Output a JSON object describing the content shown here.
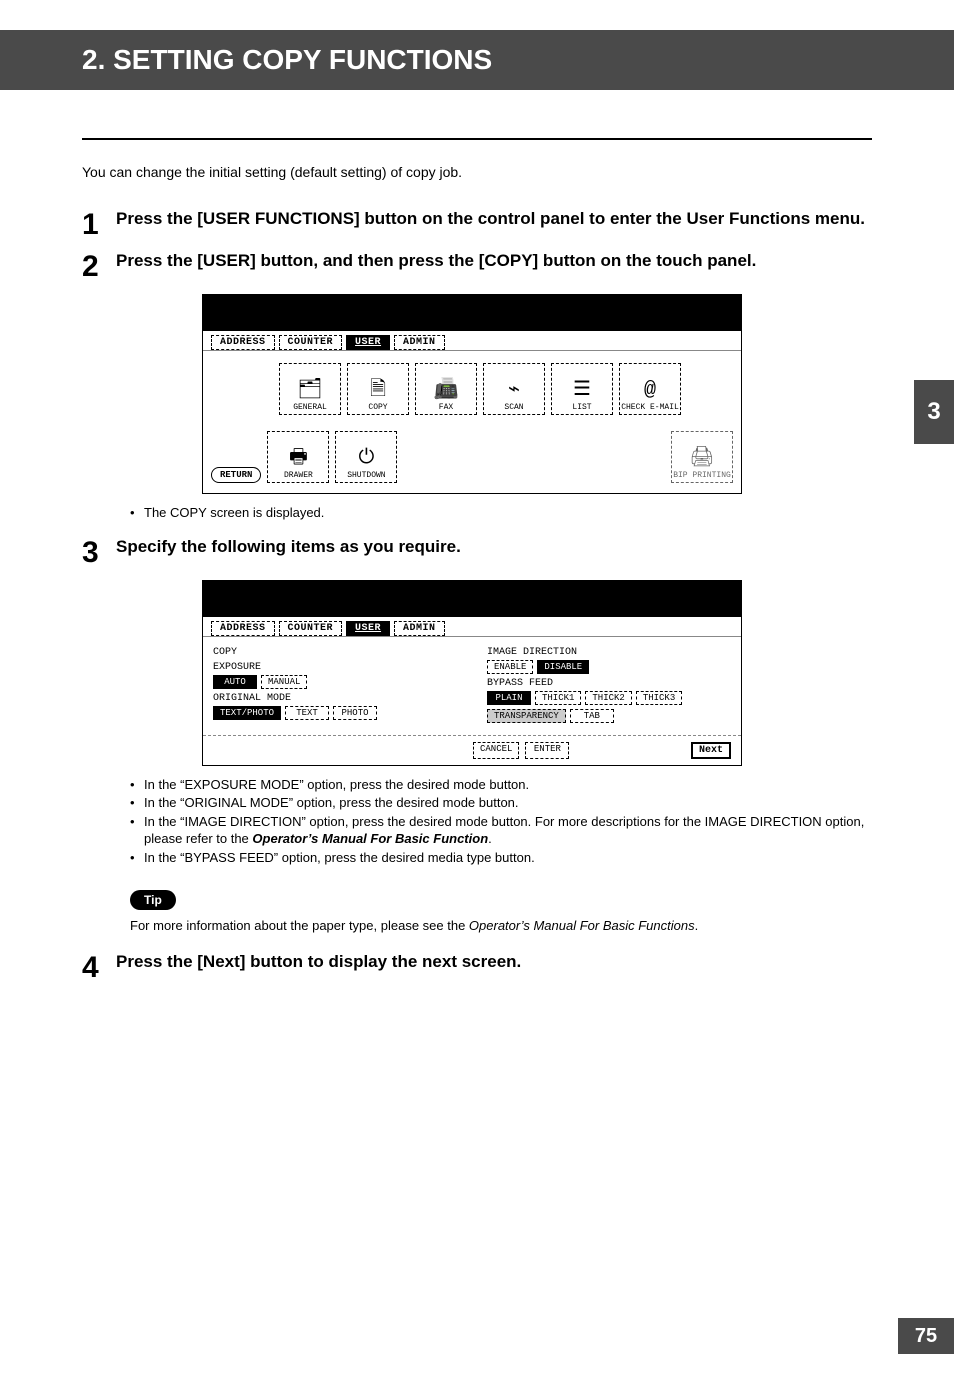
{
  "title": "2. SETTING COPY FUNCTIONS",
  "intro": "You can change the initial setting (default setting) of copy job.",
  "side_tab": "3",
  "page_number": "75",
  "steps": {
    "s1": {
      "num": "1",
      "text": "Press the [USER FUNCTIONS] button on the control panel to enter the User Functions menu."
    },
    "s2": {
      "num": "2",
      "text": "Press the [USER] button, and then press the [COPY] button on the touch panel."
    },
    "s3": {
      "num": "3",
      "text": "Specify the following items as you require."
    },
    "s4": {
      "num": "4",
      "text": "Press the [Next] button to display the next screen."
    }
  },
  "screen1": {
    "tabs": {
      "address": "ADDRESS",
      "counter": "COUNTER",
      "user": "USER",
      "admin": "ADMIN"
    },
    "buttons": {
      "general": "GENERAL",
      "copy": "COPY",
      "fax": "FAX",
      "scan": "SCAN",
      "list": "LIST",
      "check_email": "CHECK E-MAIL",
      "drawer": "DRAWER",
      "shutdown": "SHUTDOWN",
      "bip_printing": "BIP PRINTING",
      "return": "RETURN"
    }
  },
  "step2_bullet": "The COPY screen is displayed.",
  "screen2": {
    "tabs": {
      "address": "ADDRESS",
      "counter": "COUNTER",
      "user": "USER",
      "admin": "ADMIN"
    },
    "section_title": "COPY",
    "exposure": {
      "label": "EXPOSURE",
      "auto": "AUTO",
      "manual": "MANUAL"
    },
    "original_mode": {
      "label": "ORIGINAL MODE",
      "text_photo": "TEXT/PHOTO",
      "text": "TEXT",
      "photo": "PHOTO"
    },
    "image_direction": {
      "label": "IMAGE DIRECTION",
      "enable": "ENABLE",
      "disable": "DISABLE"
    },
    "bypass_feed": {
      "label": "BYPASS FEED",
      "plain": "PLAIN",
      "thick1": "THICK1",
      "thick2": "THICK2",
      "thick3": "THICK3",
      "transparency": "TRANSPARENCY",
      "tab": "TAB"
    },
    "footer": {
      "cancel": "CANCEL",
      "enter": "ENTER",
      "next": "Next"
    }
  },
  "step3_bullets": {
    "b1": "In the “EXPOSURE MODE” option, press the desired mode button.",
    "b2": "In the “ORIGINAL MODE” option, press the desired mode button.",
    "b3a": "In the “IMAGE DIRECTION” option, press the desired mode button.  For more descriptions for the IMAGE DIRECTION option, please refer to the ",
    "b3_manual": "Operator’s Manual For Basic Function",
    "b3b": ".",
    "b4": "In the “BYPASS FEED” option, press the desired media type button."
  },
  "tip": {
    "label": "Tip",
    "text_a": "For more information about the paper type, please see the ",
    "manual": "Operator’s Manual For Basic Functions",
    "text_b": "."
  }
}
